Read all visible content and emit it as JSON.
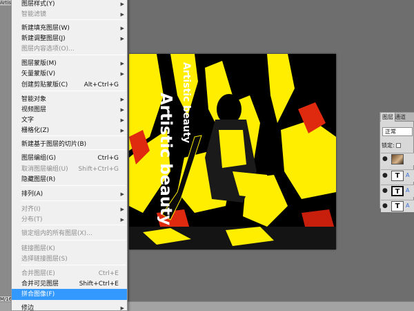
{
  "window": {
    "left_strip_caption": "Artis",
    "zoom_readout": "M/16"
  },
  "canvas": {
    "text_small": "Artistic beauty",
    "text_large": "Artistic beauty",
    "colors": {
      "primary": "#ffee00",
      "secondary": "#000000",
      "accent": "#e02a10"
    }
  },
  "menu": {
    "items": [
      {
        "label": "图层样式(Y)",
        "shortcut": "",
        "arrow": "▶",
        "disabled": false,
        "highlight": false
      },
      {
        "label": "智能滤镜",
        "shortcut": "",
        "arrow": "▶",
        "disabled": true,
        "highlight": false
      },
      {
        "label": "新建填充图层(W)",
        "shortcut": "",
        "arrow": "▶",
        "disabled": false,
        "highlight": false
      },
      {
        "label": "新建调整图层(J)",
        "shortcut": "",
        "arrow": "▶",
        "disabled": false,
        "highlight": false
      },
      {
        "label": "图层内容选项(O)...",
        "shortcut": "",
        "arrow": "",
        "disabled": true,
        "highlight": false
      },
      {
        "label": "图层蒙版(M)",
        "shortcut": "",
        "arrow": "▶",
        "disabled": false,
        "highlight": false
      },
      {
        "label": "矢量蒙版(V)",
        "shortcut": "",
        "arrow": "▶",
        "disabled": false,
        "highlight": false
      },
      {
        "label": "创建剪贴蒙版(C)",
        "shortcut": "Alt+Ctrl+G",
        "arrow": "",
        "disabled": false,
        "highlight": false
      },
      {
        "label": "智能对象",
        "shortcut": "",
        "arrow": "▶",
        "disabled": false,
        "highlight": false
      },
      {
        "label": "视频图层",
        "shortcut": "",
        "arrow": "▶",
        "disabled": false,
        "highlight": false
      },
      {
        "label": "文字",
        "shortcut": "",
        "arrow": "▶",
        "disabled": false,
        "highlight": false
      },
      {
        "label": "栅格化(Z)",
        "shortcut": "",
        "arrow": "▶",
        "disabled": false,
        "highlight": false
      },
      {
        "label": "新建基于图层的切片(B)",
        "shortcut": "",
        "arrow": "",
        "disabled": false,
        "highlight": false
      },
      {
        "label": "图层编组(G)",
        "shortcut": "Ctrl+G",
        "arrow": "",
        "disabled": false,
        "highlight": false
      },
      {
        "label": "取消图层编组(U)",
        "shortcut": "Shift+Ctrl+G",
        "arrow": "",
        "disabled": true,
        "highlight": false
      },
      {
        "label": "隐藏图层(R)",
        "shortcut": "",
        "arrow": "",
        "disabled": false,
        "highlight": false
      },
      {
        "label": "排列(A)",
        "shortcut": "",
        "arrow": "▶",
        "disabled": false,
        "highlight": false
      },
      {
        "label": "对齐(I)",
        "shortcut": "",
        "arrow": "▶",
        "disabled": true,
        "highlight": false
      },
      {
        "label": "分布(T)",
        "shortcut": "",
        "arrow": "▶",
        "disabled": true,
        "highlight": false
      },
      {
        "label": "锁定组内的所有图层(X)...",
        "shortcut": "",
        "arrow": "",
        "disabled": true,
        "highlight": false
      },
      {
        "label": "链接图层(K)",
        "shortcut": "",
        "arrow": "",
        "disabled": true,
        "highlight": false
      },
      {
        "label": "选择链接图层(S)",
        "shortcut": "",
        "arrow": "",
        "disabled": true,
        "highlight": false
      },
      {
        "label": "合并图层(E)",
        "shortcut": "Ctrl+E",
        "arrow": "",
        "disabled": true,
        "highlight": false
      },
      {
        "label": "合并可见图层",
        "shortcut": "Shift+Ctrl+E",
        "arrow": "",
        "disabled": false,
        "highlight": false
      },
      {
        "label": "拼合图像(F)",
        "shortcut": "",
        "arrow": "",
        "disabled": false,
        "highlight": true
      },
      {
        "label": "修边",
        "shortcut": "",
        "arrow": "▶",
        "disabled": false,
        "highlight": false
      }
    ]
  },
  "layers_panel": {
    "tab_layers": "图层",
    "tab_channels": "通道",
    "blend_mode": "正常",
    "lock_label": "锁定:",
    "layers": [
      {
        "thumb": "",
        "name": "",
        "type": "image"
      },
      {
        "thumb": "T",
        "name": "A",
        "type": "text"
      },
      {
        "thumb": "T",
        "name": "A",
        "type": "text-selected"
      },
      {
        "thumb": "T",
        "name": "A",
        "type": "text"
      }
    ]
  }
}
